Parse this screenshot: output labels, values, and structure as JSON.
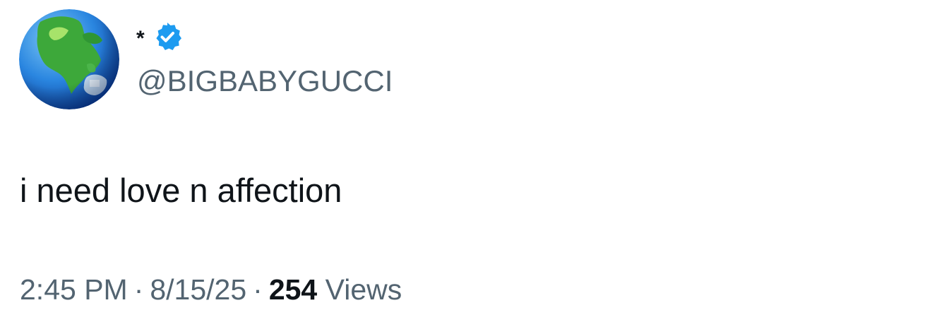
{
  "tweet": {
    "author": {
      "display_name": "*",
      "handle": "@BIGBABYGUCCI",
      "verified": true,
      "avatar_icon": "earth-globe-icon"
    },
    "text": "i need love n affection",
    "meta": {
      "time": "2:45 PM",
      "date": "8/15/25",
      "separator": "·",
      "views_count": "254",
      "views_label": "Views"
    }
  },
  "colors": {
    "text_primary": "#0f1419",
    "text_secondary": "#536471",
    "verified_blue": "#1d9bf0"
  }
}
